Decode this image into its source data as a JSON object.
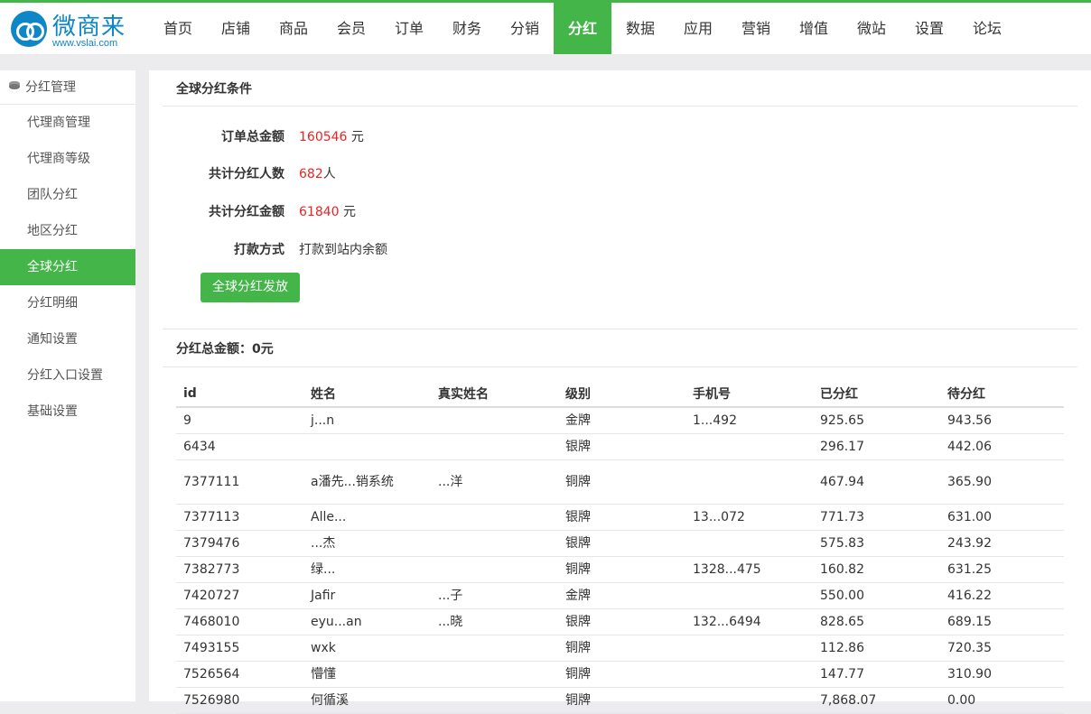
{
  "brand": {
    "name": "微商来",
    "url": "www.vslai.com"
  },
  "nav": [
    "首页",
    "店铺",
    "商品",
    "会员",
    "订单",
    "财务",
    "分销",
    "分红",
    "数据",
    "应用",
    "营销",
    "增值",
    "微站",
    "设置",
    "论坛"
  ],
  "nav_active": "分红",
  "sidebar": {
    "header": "分红管理",
    "items": [
      "代理商管理",
      "代理商等级",
      "团队分红",
      "地区分红",
      "全球分红",
      "分红明细",
      "通知设置",
      "分红入口设置",
      "基础设置"
    ],
    "active": "全球分红"
  },
  "conditions": {
    "title": "全球分红条件",
    "order_total_label": "订单总金额",
    "order_total_value": "160546",
    "order_total_unit": "元",
    "people_label": "共计分红人数",
    "people_value": "682",
    "people_unit": "人",
    "amount_label": "共计分红金额",
    "amount_value": "61840",
    "amount_unit": "元",
    "pay_label": "打款方式",
    "pay_value": "打款到站内余额",
    "button": "全球分红发放"
  },
  "summary": "分红总金额：0元",
  "table": {
    "headers": [
      "id",
      "姓名",
      "真实姓名",
      "级别",
      "手机号",
      "已分红",
      "待分红"
    ],
    "rows": [
      [
        "9",
        "j...n",
        "",
        "金牌",
        "1...492",
        "925.65",
        "943.56"
      ],
      [
        "6434",
        "",
        "",
        "银牌",
        "",
        "296.17",
        "442.06"
      ],
      [
        "7377111",
        "a潘先...销系统",
        "...洋",
        "铜牌",
        "",
        "467.94",
        "365.90"
      ],
      [
        "7377113",
        "Alle...",
        "",
        "银牌",
        "13...072",
        "771.73",
        "631.00"
      ],
      [
        "7379476",
        "...杰",
        "",
        "银牌",
        "",
        "575.83",
        "243.92"
      ],
      [
        "7382773",
        "绿...",
        "",
        "铜牌",
        "1328...475",
        "160.82",
        "631.25"
      ],
      [
        "7420727",
        "Jafir",
        "...子",
        "金牌",
        "",
        "550.00",
        "416.22"
      ],
      [
        "7468010",
        "eyu...an",
        "...晓",
        "银牌",
        "132...6494",
        "828.65",
        "689.15"
      ],
      [
        "7493155",
        "wxk",
        "",
        "铜牌",
        "",
        "112.86",
        "720.35"
      ],
      [
        "7526564",
        "懵懂",
        "",
        "铜牌",
        "",
        "147.77",
        "310.90"
      ],
      [
        "7526980",
        "何循溪",
        "",
        "铜牌",
        "",
        "7,868.07",
        "0.00"
      ]
    ]
  }
}
